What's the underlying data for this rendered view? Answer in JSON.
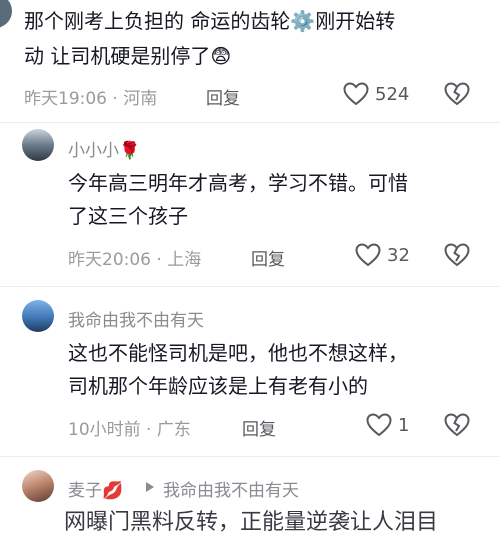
{
  "comments": [
    {
      "lines": [
        "那个刚考上负担的 命运的齿轮⚙️刚开始转",
        "动   让司机硬是别停了😨"
      ],
      "time": "昨天19:06",
      "location": "河南",
      "reply_label": "回复",
      "likes": "524"
    },
    {
      "username": "小小小🌹",
      "lines": [
        "今年高三明年才高考，学习不错。可惜",
        "了这三个孩子"
      ],
      "time": "昨天20:06",
      "location": "上海",
      "reply_label": "回复",
      "likes": "32"
    },
    {
      "username": "我命由我不由有天",
      "lines": [
        "这也不能怪司机是吧，他也不想这样，",
        "司机那个年龄应该是上有老有小的"
      ],
      "time": "10小时前",
      "location": "广东",
      "reply_label": "回复",
      "likes": "1"
    },
    {
      "username": "麦子💋",
      "reply_to": "我命由我不由有天"
    }
  ],
  "watermark": "网曝门黑料反转，正能量逆袭让人泪目"
}
